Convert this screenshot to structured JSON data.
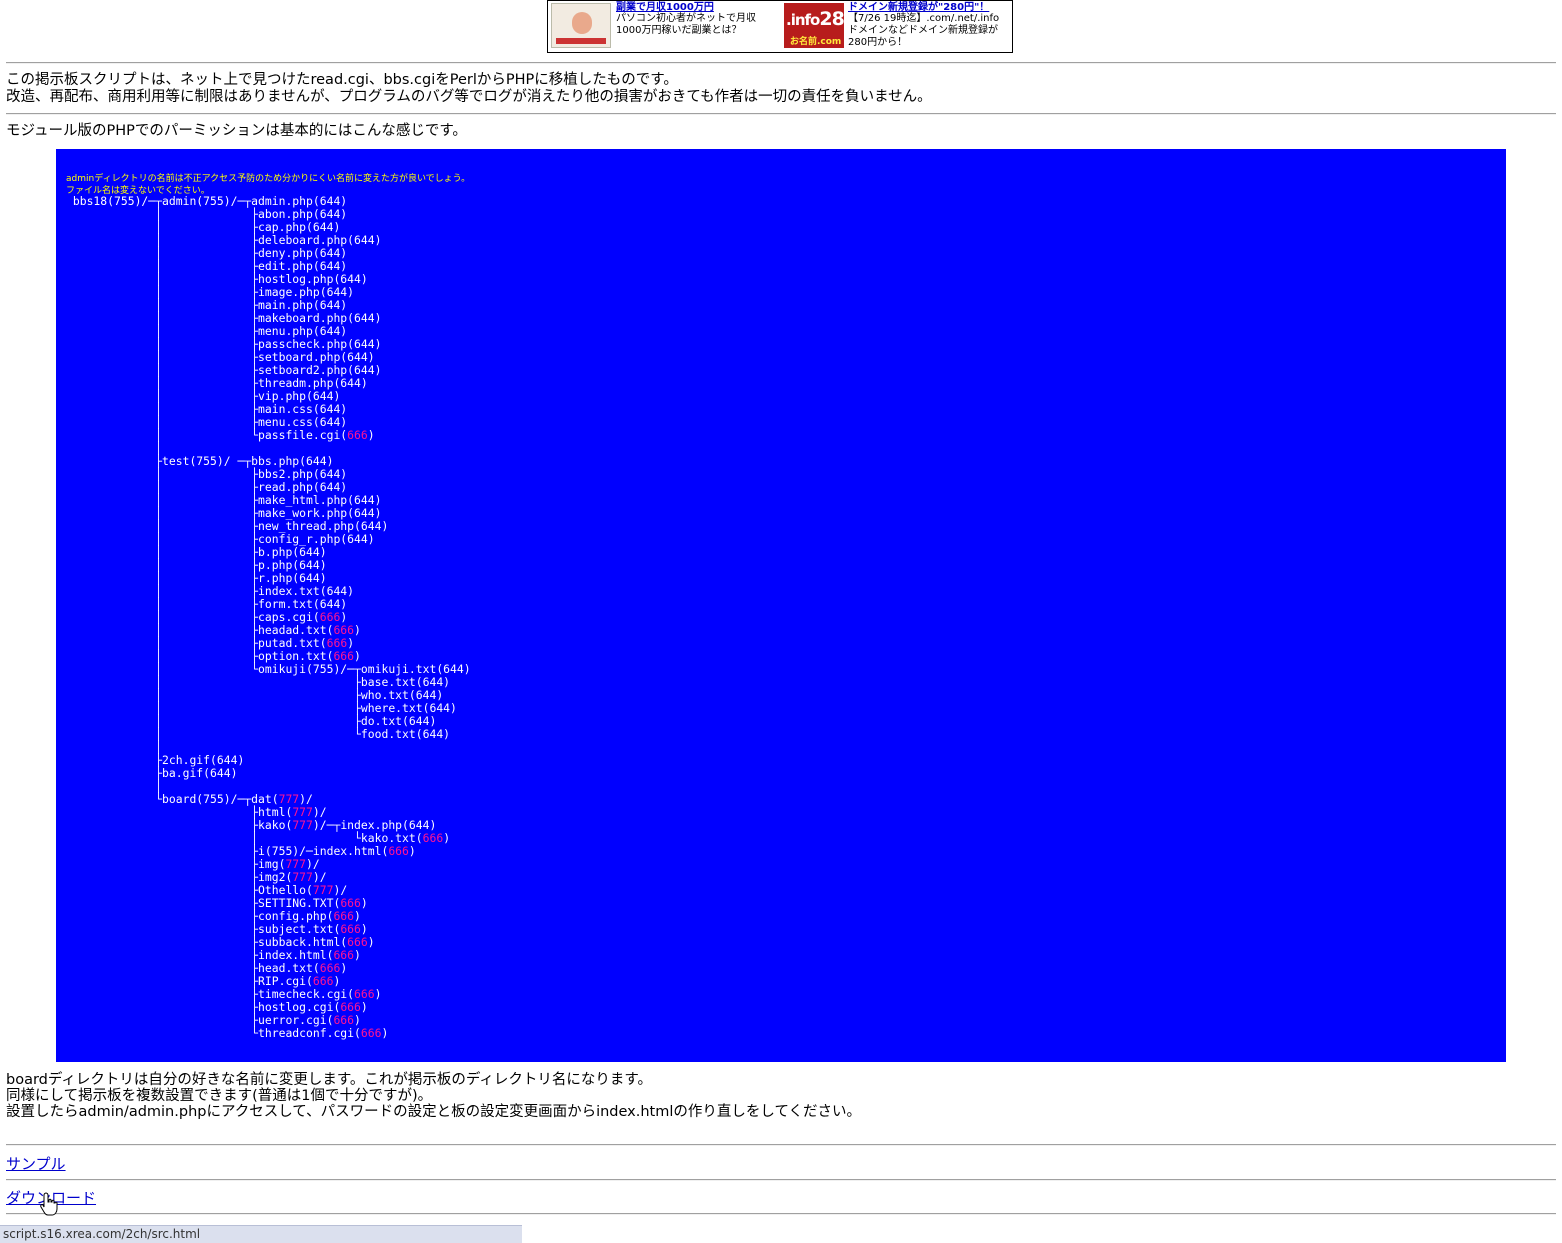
{
  "ad": {
    "left": {
      "title": "副業で月収1000万円",
      "desc": "パソコン初心者がネットで月収1000万円稼いだ副業とは？"
    },
    "right": {
      "title": "ドメイン新規登録が\"280円\"！",
      "desc": "【7/26 19時迄】.com/.net/.info ドメインなどドメイン新規登録が280円から！",
      "badge_text": ".info",
      "badge_price": "280",
      "badge_sub": "お名前.com"
    }
  },
  "intro": {
    "line1": "この掲示板スクリプトは、ネット上で見つけたread.cgi、bbs.cgiをPerlからPHPに移植したものです。",
    "line2": "改造、再配布、商用利用等に制限はありませんが、プログラムのバグ等でログが消えたり他の損害がおきても作者は一切の責任を負いません。"
  },
  "permission_heading": "モジュール版のPHPでのパーミッションは基本的にはこんな感じです。",
  "tree": {
    "note": "adminディレクトリの名前は不正アクセス予防のため分かりにくい名前に変えた方が良いでしょう。\nファイル名は変えないでください。",
    "lines": [
      [
        " bbs18(755)/─┬admin(755)/─┬admin.php(644)"
      ],
      [
        "             │             ├abon.php(644)"
      ],
      [
        "             │             ├cap.php(644)"
      ],
      [
        "             │             ├deleboard.php(644)"
      ],
      [
        "             │             ├deny.php(644)"
      ],
      [
        "             │             ├edit.php(644)"
      ],
      [
        "             │             ├hostlog.php(644)"
      ],
      [
        "             │             ├image.php(644)"
      ],
      [
        "             │             ├main.php(644)"
      ],
      [
        "             │             ├makeboard.php(644)"
      ],
      [
        "             │             ├menu.php(644)"
      ],
      [
        "             │             ├passcheck.php(644)"
      ],
      [
        "             │             ├setboard.php(644)"
      ],
      [
        "             │             ├setboard2.php(644)"
      ],
      [
        "             │             ├threadm.php(644)"
      ],
      [
        "             │             ├vip.php(644)"
      ],
      [
        "             │             ├main.css(644)"
      ],
      [
        "             │             ├menu.css(644)"
      ],
      [
        "             │             └passfile.cgi(",
        "666",
        ")"
      ],
      [
        "             │"
      ],
      [
        "             ├test(755)/ ─┬bbs.php(644)"
      ],
      [
        "             │             ├bbs2.php(644)"
      ],
      [
        "             │             ├read.php(644)"
      ],
      [
        "             │             ├make_html.php(644)"
      ],
      [
        "             │             ├make_work.php(644)"
      ],
      [
        "             │             ├new_thread.php(644)"
      ],
      [
        "             │             ├config_r.php(644)"
      ],
      [
        "             │             ├b.php(644)"
      ],
      [
        "             │             ├p.php(644)"
      ],
      [
        "             │             ├r.php(644)"
      ],
      [
        "             │             ├index.txt(644)"
      ],
      [
        "             │             ├form.txt(644)"
      ],
      [
        "             │             ├caps.cgi(",
        "666",
        ")"
      ],
      [
        "             │             ├headad.txt(",
        "666",
        ")"
      ],
      [
        "             │             ├putad.txt(",
        "666",
        ")"
      ],
      [
        "             │             ├option.txt(",
        "666",
        ")"
      ],
      [
        "             │             └omikuji(755)/─┬omikuji.txt(644)"
      ],
      [
        "             │                            ├base.txt(644)"
      ],
      [
        "             │                            ├who.txt(644)"
      ],
      [
        "             │                            ├where.txt(644)"
      ],
      [
        "             │                            ├do.txt(644)"
      ],
      [
        "             │                            └food.txt(644)"
      ],
      [
        "             │"
      ],
      [
        "             ├2ch.gif(644)"
      ],
      [
        "             ├ba.gif(644)"
      ],
      [
        "             │"
      ],
      [
        "             └board(755)/─┬dat(",
        "777",
        ")/"
      ],
      [
        "                           ├html(",
        "777",
        ")/"
      ],
      [
        "                           ├kako(",
        "777",
        ")/─┬index.php(644)"
      ],
      [
        "                           │              └kako.txt(",
        "666",
        ")"
      ],
      [
        "                           ├i(755)/─index.html(",
        "666",
        ")"
      ],
      [
        "                           ├img(",
        "777",
        ")/"
      ],
      [
        "                           ├img2(",
        "777",
        ")/"
      ],
      [
        "                           ├Othello(",
        "777",
        ")/"
      ],
      [
        "                           ├SETTING.TXT(",
        "666",
        ")"
      ],
      [
        "                           ├config.php(",
        "666",
        ")"
      ],
      [
        "                           ├subject.txt(",
        "666",
        ")"
      ],
      [
        "                           ├subback.html(",
        "666",
        ")"
      ],
      [
        "                           ├index.html(",
        "666",
        ")"
      ],
      [
        "                           ├head.txt(",
        "666",
        ")"
      ],
      [
        "                           ├RIP.cgi(",
        "666",
        ")"
      ],
      [
        "                           ├timecheck.cgi(",
        "666",
        ")"
      ],
      [
        "                           ├hostlog.cgi(",
        "666",
        ")"
      ],
      [
        "                           ├uerror.cgi(",
        "666",
        ")"
      ],
      [
        "                           └threadconf.cgi(",
        "666",
        ")"
      ]
    ]
  },
  "after": {
    "line1": "boardディレクトリは自分の好きな名前に変更します。これが掲示板のディレクトリ名になります。",
    "line2": "同様にして掲示板を複数設置できます(普通は1個で十分ですが)。",
    "line3": "設置したらadmin/admin.phpにアクセスして、パスワードの設定と板の設定変更画面からindex.htmlの作り直しをしてください。"
  },
  "links": {
    "sample": "サンプル",
    "download": "ダウンロード"
  },
  "status_bar": {
    "url": "script.s16.xrea.com/2ch/src.html"
  },
  "colors": {
    "tree_background": "#0000ff",
    "permission_highlight": "#ff1493",
    "note_text": "#ffff00",
    "link": "#0000cc"
  }
}
